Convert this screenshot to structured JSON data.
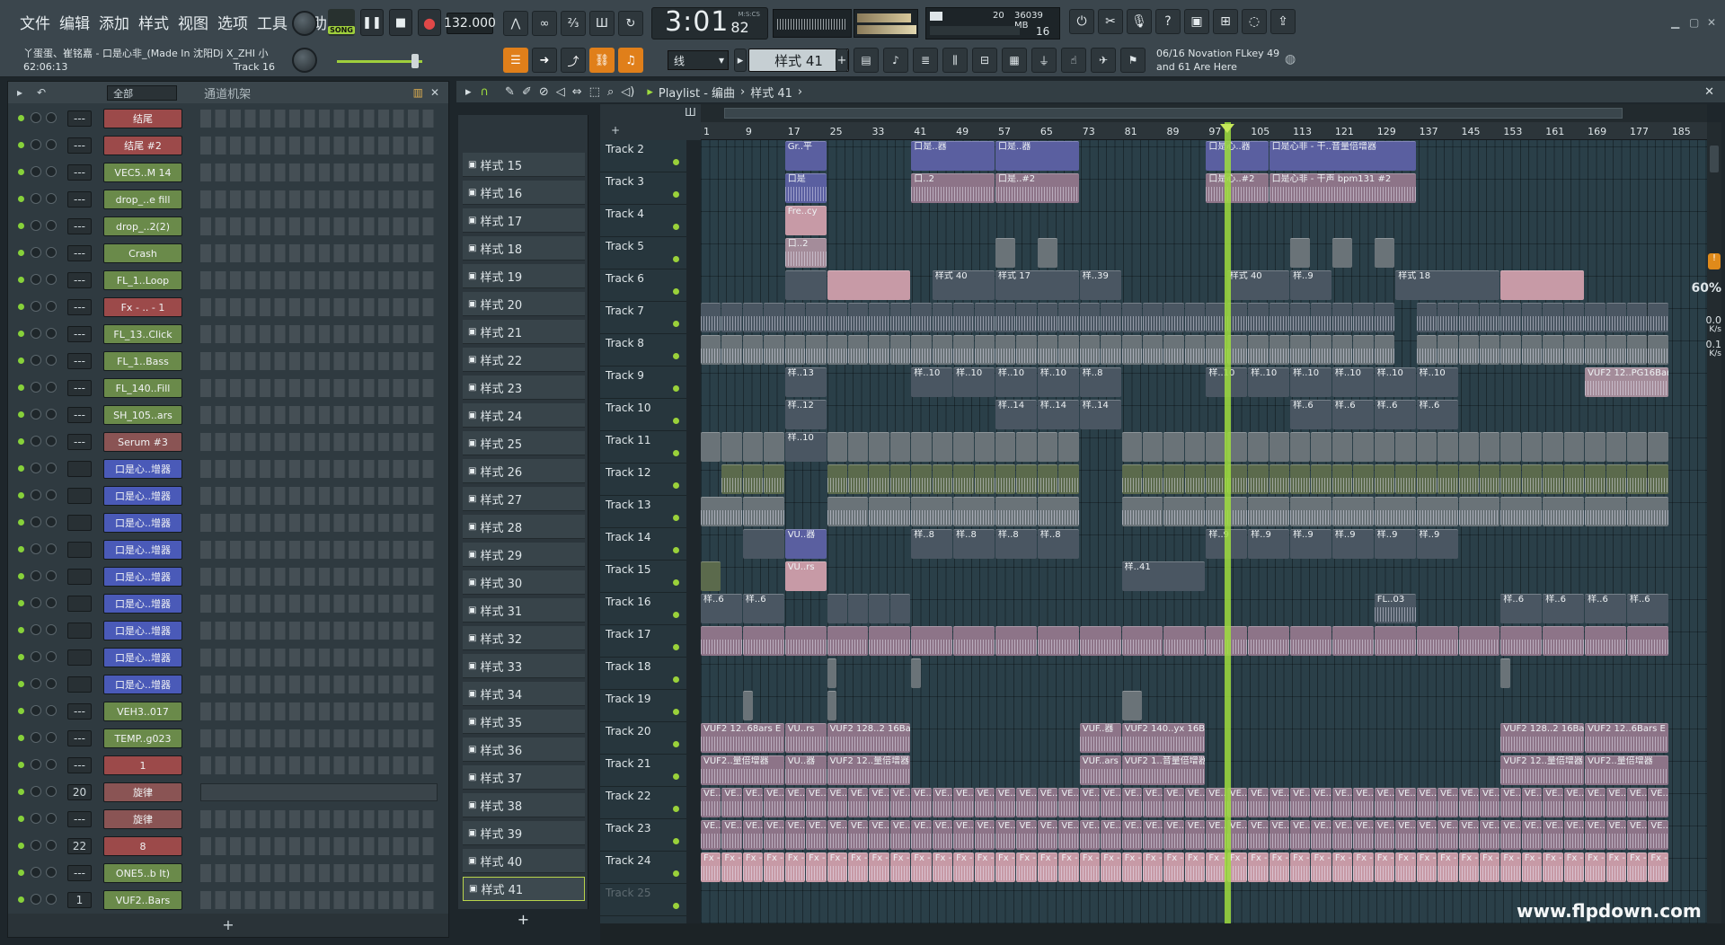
{
  "menu": [
    "文件",
    "编辑",
    "添加",
    "样式",
    "视图",
    "选项",
    "工具",
    "帮助"
  ],
  "song": {
    "title": "丫蛋蛋、崔铭嘉 - 口是心非_(Made In 沈阳Dj X_ZHI 小",
    "time": "62:06:13",
    "track": "Track 16"
  },
  "transport": {
    "pat_song": "SONG",
    "tempo": "132.000",
    "clock_main": "3:01",
    "clock_sub": "82",
    "clock_unit": "M:S:CS"
  },
  "memory": {
    "cpu": "20",
    "ram": "36039 MB",
    "poly": "16"
  },
  "snap_value": "线",
  "current_pattern": "样式 41",
  "hint": {
    "line1": "06/16  Novation FLkey 49",
    "line2": "and 61 Are Here"
  },
  "rack": {
    "filter": "全部",
    "title": "通道机架",
    "channels": [
      {
        "route": "---",
        "name": "结尾",
        "color": "red"
      },
      {
        "route": "---",
        "name": "结尾 #2",
        "color": "red"
      },
      {
        "route": "---",
        "name": "VEC5..M 14",
        "color": "green"
      },
      {
        "route": "---",
        "name": "drop_..e fill",
        "color": "green"
      },
      {
        "route": "---",
        "name": "drop_..2(2)",
        "color": "green"
      },
      {
        "route": "---",
        "name": "Crash",
        "color": "green"
      },
      {
        "route": "---",
        "name": "FL_1..Loop",
        "color": "green"
      },
      {
        "route": "---",
        "name": "Fx - .. - 1",
        "color": "red"
      },
      {
        "route": "---",
        "name": "FL_13..Click",
        "color": "green"
      },
      {
        "route": "---",
        "name": "FL_1..Bass",
        "color": "green"
      },
      {
        "route": "---",
        "name": "FL_140..Fill",
        "color": "green"
      },
      {
        "route": "---",
        "name": "SH_105..ars",
        "color": "green"
      },
      {
        "route": "---",
        "name": "Serum #3",
        "color": "brown"
      },
      {
        "route": "",
        "name": "口是心..增器",
        "color": "blue"
      },
      {
        "route": "",
        "name": "口是心..增器",
        "color": "blue"
      },
      {
        "route": "",
        "name": "口是心..增器",
        "color": "blue"
      },
      {
        "route": "",
        "name": "口是心..增器",
        "color": "blue"
      },
      {
        "route": "",
        "name": "口是心..增器",
        "color": "blue"
      },
      {
        "route": "",
        "name": "口是心..增器",
        "color": "blue"
      },
      {
        "route": "",
        "name": "口是心..增器",
        "color": "blue"
      },
      {
        "route": "",
        "name": "口是心..增器",
        "color": "blue"
      },
      {
        "route": "",
        "name": "口是心..增器",
        "color": "blue"
      },
      {
        "route": "---",
        "name": "VEH3..017",
        "color": "green"
      },
      {
        "route": "---",
        "name": "TEMP..g023",
        "color": "green"
      },
      {
        "route": "---",
        "name": "1",
        "color": "red"
      },
      {
        "route": "20",
        "name": "旋律",
        "color": "brown"
      },
      {
        "route": "---",
        "name": "旋律",
        "color": "brown"
      },
      {
        "route": "22",
        "name": "8",
        "color": "red"
      },
      {
        "route": "---",
        "name": "ONE5..b It)",
        "color": "green"
      },
      {
        "route": "1",
        "name": "VUF2..Bars",
        "color": "green"
      }
    ]
  },
  "picker": {
    "patterns": [
      "样式 15",
      "样式 16",
      "样式 17",
      "样式 18",
      "样式 19",
      "样式 20",
      "样式 21",
      "样式 22",
      "样式 23",
      "样式 24",
      "样式 25",
      "样式 26",
      "样式 27",
      "样式 28",
      "样式 29",
      "样式 30",
      "样式 31",
      "样式 32",
      "样式 33",
      "样式 34",
      "样式 35",
      "样式 36",
      "样式 37",
      "样式 38",
      "样式 39",
      "样式 40",
      "样式 41"
    ]
  },
  "playlist": {
    "title": "Playlist - 编曲",
    "pattern": "样式 41",
    "bars": [
      "1",
      "9",
      "17",
      "25",
      "33",
      "41",
      "49",
      "57",
      "65",
      "73",
      "81",
      "89",
      "97",
      "105",
      "113",
      "121",
      "129",
      "137",
      "145",
      "153",
      "161",
      "169",
      "177",
      "185"
    ],
    "tracks": [
      "Track 2",
      "Track 3",
      "Track 4",
      "Track 5",
      "Track 6",
      "Track 7",
      "Track 8",
      "Track 9",
      "Track 10",
      "Track 11",
      "Track 12",
      "Track 13",
      "Track 14",
      "Track 15",
      "Track 16",
      "Track 17",
      "Track 18",
      "Track 19",
      "Track 20",
      "Track 21",
      "Track 22",
      "Track 23",
      "Track 24",
      "Track 25"
    ],
    "clip_labels": {
      "t2a": "Gr..平",
      "t2b": "口是..器",
      "t2c": "口是..器",
      "t2d": "口是心..器",
      "t2e": "口是心非 - 干..音量倍增器",
      "t3a": "口是",
      "t3b": "口..2",
      "t3c": "口是..#2",
      "t3d": "口是心..#2",
      "t3e": "口是心非 - 干声 bpm131 #2",
      "t4a": "Fre..cy",
      "t5a": "口..2",
      "t6a": "样式 40",
      "t6b": "样式 17",
      "t6c": "样..39",
      "t6d": "样式 40",
      "t6e": "样..9",
      "t6f": "样式 18",
      "t9a": "样..13",
      "t9b": "样..10",
      "t9c": "样..8",
      "t9d": "VUF2 12..PG16Bar",
      "t10a": "样..12",
      "t10b": "样..14",
      "t10c": "样..6",
      "t11a": "样..10",
      "t14a": "VU..器",
      "t14b": "样..8",
      "t14c": "样..9",
      "t15a": "VU..rs",
      "t15b": "样..41",
      "t16a": "样..6",
      "t16b": "FL..03",
      "t16c": "样..6",
      "t20a": "VUF2 12..68ars E",
      "t20b": "VU..rs",
      "t20c": "VUF2 128..2 16Bar",
      "t20d": "VUF..器",
      "t20e": "VUF2 140..yx 16Bars",
      "t20f": "VUF2 128..2 16Ba",
      "t20g": "VUF2 12..6Bars E",
      "t21a": "VUF2..量倍增器",
      "t21b": "VU..器",
      "t21c": "VUF2 12..量倍增器",
      "t21d": "VUF..ars",
      "t21e": "VUF2 1..音量倍增器",
      "t21f": "VUF2 12..量倍增器",
      "t21g": "VUF2..量倍增器",
      "t22": "VE..99",
      "t23": "VE..#2",
      "t24": "Fx - ..1"
    }
  },
  "stats": {
    "pct": "60%",
    "a": "0.0",
    "b": "0.1",
    "unit": "K/s"
  },
  "watermark": "www.flpdown.com"
}
